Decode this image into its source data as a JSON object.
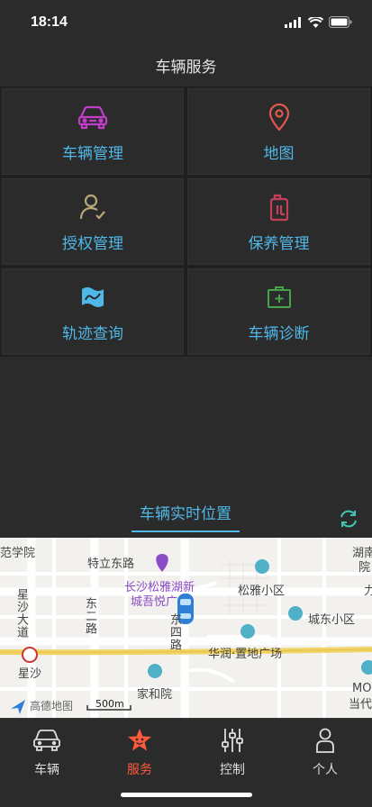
{
  "status": {
    "time": "18:14"
  },
  "header": {
    "title": "车辆服务"
  },
  "services": [
    {
      "label": "车辆管理",
      "icon": "car-icon",
      "color": "#c13cc7"
    },
    {
      "label": "地图",
      "icon": "map-pin-icon",
      "color": "#e0584f"
    },
    {
      "label": "授权管理",
      "icon": "user-check-icon",
      "color": "#b8a878"
    },
    {
      "label": "保养管理",
      "icon": "oil-can-icon",
      "color": "#c2405a"
    },
    {
      "label": "轨迹查询",
      "icon": "route-map-icon",
      "color": "#4fb8e8"
    },
    {
      "label": "车辆诊断",
      "icon": "first-aid-kit-icon",
      "color": "#47a34a"
    }
  ],
  "map_section": {
    "tab_label": "车辆实时位置",
    "accent": "#4fb8e8"
  },
  "map": {
    "labels": {
      "l1": "范学院",
      "l2": "特立东路",
      "l3": "湖南",
      "l3b": "院",
      "l4": "长沙松雅湖新",
      "l5": "城吾悦广",
      "l6": "松雅小区",
      "l7": "城东小区",
      "l8": "星沙大道",
      "l9": "东二路",
      "l10": "东四路",
      "l11": "华润·置地广场",
      "l12": "星沙",
      "l13": "家和院",
      "l14": "MO",
      "l15": "当代",
      "l16": "力"
    },
    "logo_text": "高德地图",
    "scale": "500m"
  },
  "tabbar": {
    "items": [
      {
        "label": "车辆",
        "icon": "car-outline-icon",
        "active": false
      },
      {
        "label": "服务",
        "icon": "service-star-icon",
        "active": true
      },
      {
        "label": "控制",
        "icon": "sliders-icon",
        "active": false
      },
      {
        "label": "个人",
        "icon": "person-icon",
        "active": false
      }
    ],
    "active_color": "#ff5a3c"
  }
}
